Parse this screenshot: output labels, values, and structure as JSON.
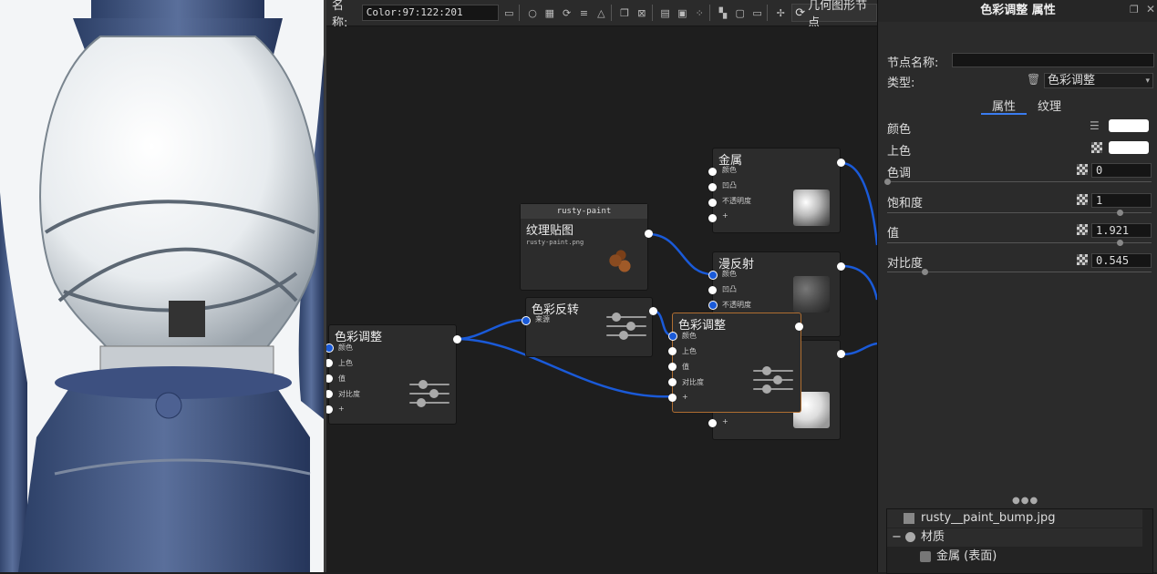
{
  "toolbar": {
    "name_label": "名称:",
    "name_value": "Color:97:122:201",
    "geometry_button": "几何图形节点",
    "icons": [
      "save-icon",
      "render-icon",
      "checker-icon",
      "rotate-icon",
      "sliders-icon",
      "warning-icon",
      "copy-icon",
      "delete-icon",
      "grid-icon",
      "tree-icon",
      "dots-icon",
      "layout-icon",
      "frame-icon",
      "fit-icon",
      "move-icon"
    ]
  },
  "nodes": {
    "metal": {
      "title": "金属",
      "ports": [
        "颜色",
        "凹凸",
        "不透明度",
        "+"
      ]
    },
    "texture": {
      "header": "rusty-paint",
      "title": "纹理贴图",
      "file": "rusty-paint.png"
    },
    "diffuse": {
      "title": "漫反射",
      "ports": [
        "颜色",
        "凹凸",
        "不透明度"
      ]
    },
    "invert": {
      "title": "色彩反转",
      "ports": [
        "来源"
      ]
    },
    "color_adjust_left": {
      "title": "色彩调整",
      "ports": [
        "颜色",
        "上色",
        "值",
        "对比度",
        "+"
      ]
    },
    "color_adjust_sel": {
      "title": "色彩调整",
      "ports": [
        "颜色",
        "上色",
        "值",
        "对比度",
        "+"
      ]
    },
    "hidden_node": {
      "ports": [
        "+"
      ]
    }
  },
  "panel": {
    "title": "色彩调整 属性",
    "node_name_label": "节点名称:",
    "node_name_value": "",
    "type_label": "类型:",
    "type_value": "色彩调整",
    "tabs": [
      "属性",
      "纹理"
    ],
    "props": [
      {
        "label": "颜色"
      },
      {
        "label": "上色"
      },
      {
        "label": "色调",
        "value": "0",
        "slider": 0.0
      },
      {
        "label": "饱和度",
        "value": "1",
        "slider": 0.88
      },
      {
        "label": "值",
        "value": "1.921",
        "slider": 0.88
      },
      {
        "label": "对比度",
        "value": "0.545",
        "slider": 0.14
      }
    ],
    "colors": {
      "swatch": "#ffffff",
      "wire": "#1a5ad8",
      "selected": "#b06e31"
    }
  },
  "tree": {
    "items": [
      {
        "label": "rusty__paint_bump.jpg"
      },
      {
        "label": "材质",
        "expander": "−"
      },
      {
        "label": "金属 (表面)"
      }
    ]
  }
}
